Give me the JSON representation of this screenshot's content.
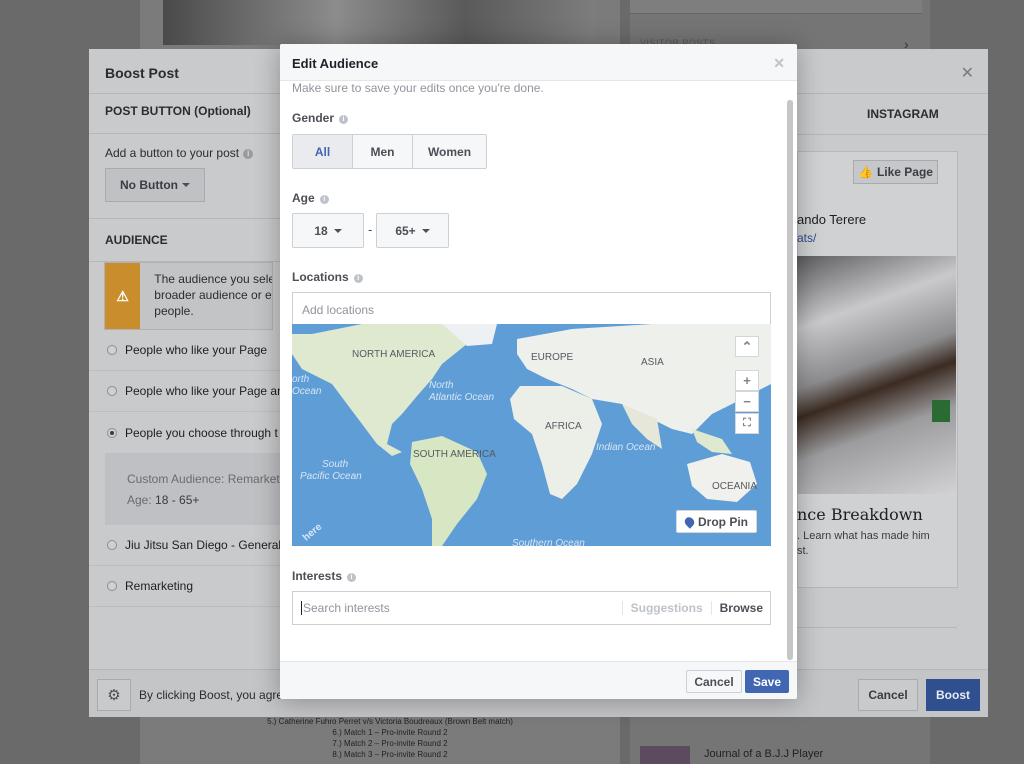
{
  "background": {
    "visitor_posts": "VISITOR POSTS",
    "bottom_lines": [
      "5.) Catherine Fuhro Perret v/s Victoria Boudreaux (Brown Belt match)",
      "6.) Match 1 – Pro-invite Round 2",
      "7.) Match 2 – Pro-invite Round 2",
      "8.) Match 3 – Pro-invite Round 2"
    ],
    "journal": "Journal of a B.J.J Player"
  },
  "boost": {
    "title": "Boost Post",
    "post_button_heading": "POST BUTTON (Optional)",
    "add_button_label": "Add a button to your post",
    "no_button": "No Button",
    "audience_heading": "AUDIENCE",
    "warning_lines": [
      "The audience you selec",
      "broader audience or edi",
      "people."
    ],
    "radios": [
      {
        "label": "People who like your Page",
        "selected": false
      },
      {
        "label": "People who like your Page an",
        "selected": false
      },
      {
        "label": "People you choose through t",
        "selected": true
      }
    ],
    "custom_audience_label": "Custom Audience: Remarketin",
    "age_label": "Age:",
    "age_value": "18 - 65+",
    "radios_more": [
      {
        "label": "Jiu Jitsu San Diego - General",
        "selected": false
      },
      {
        "label": "Remarketing",
        "selected": false
      }
    ],
    "footer_text": "By clicking Boost, you agre",
    "cancel": "Cancel",
    "boost": "Boost",
    "instagram_tab": "INSTAGRAM"
  },
  "preview": {
    "like_page": "Like Page",
    "name": "ando Terere",
    "link": "ats/",
    "headline": "nce Breakdown",
    "desc_lines": [
      ". Learn what has made him",
      "st."
    ]
  },
  "modal": {
    "title": "Edit Audience",
    "hint": "Make sure to save your edits once you're done.",
    "gender_label": "Gender",
    "gender_options": [
      "All",
      "Men",
      "Women"
    ],
    "gender_selected": "All",
    "age_label": "Age",
    "age_min": "18",
    "age_max": "65+",
    "age_sep": "-",
    "locations_label": "Locations",
    "locations_placeholder": "Add locations",
    "map_labels": {
      "north_america": "NORTH AMERICA",
      "europe": "EUROPE",
      "asia": "ASIA",
      "africa": "AFRICA",
      "south_america": "SOUTH AMERICA",
      "oceania": "OCEANIA",
      "north_atlantic": "North Atlantic Ocean",
      "north_pacific": "orth Ocean",
      "indian": "Indian Ocean",
      "south_pacific": "South Pacific Ocean",
      "southern": "Southern Ocean",
      "here": "here"
    },
    "map_controls": [
      "^",
      "+",
      "−",
      "⛶"
    ],
    "drop_pin": "Drop Pin",
    "interests_label": "Interests",
    "interests_placeholder": "Search interests",
    "suggestions": "Suggestions",
    "browse": "Browse",
    "cancel": "Cancel",
    "save": "Save"
  },
  "colors": {
    "accent": "#4267b2",
    "boost_blue": "#2f4f8f",
    "warning": "#c98d2b"
  }
}
